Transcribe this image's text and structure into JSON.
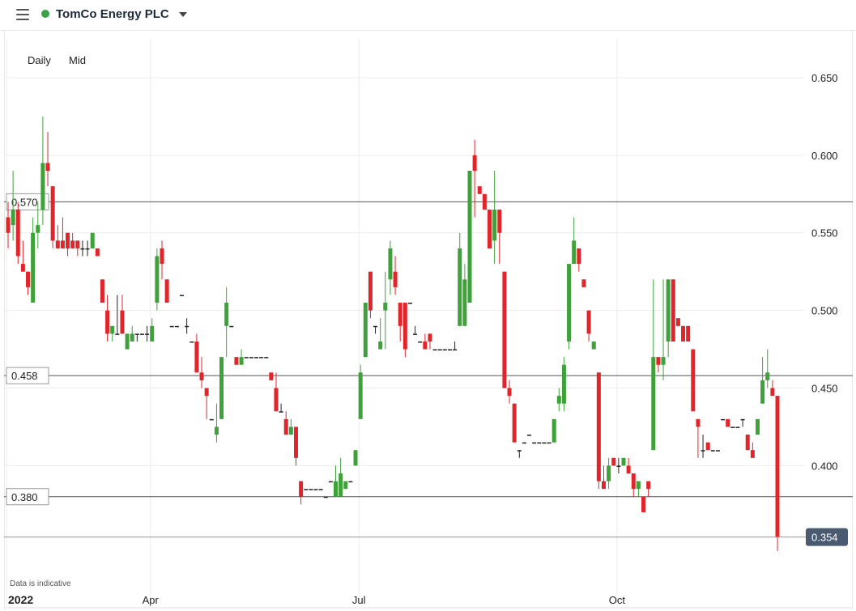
{
  "header": {
    "menu_icon": "hamburger-menu-icon",
    "status_color": "#3aa04a",
    "instrument_name": "TomCo Energy PLC",
    "dropdown_icon": "caret-down-icon"
  },
  "controls": {
    "interval_label": "Daily",
    "price_type_label": "Mid"
  },
  "disclaimer": "Data is indicative",
  "colors": {
    "up": "#3fa13a",
    "down": "#e0252b",
    "last_price_bg": "#4a5a70"
  },
  "chart_data": {
    "type": "candlestick",
    "y_axis_side": "right",
    "ylim": [
      0.31,
      0.675
    ],
    "y_ticks": [
      0.65,
      0.6,
      0.55,
      0.5,
      0.45,
      0.4
    ],
    "y_tick_labels": [
      "0.650",
      "0.600",
      "0.550",
      "0.500",
      "0.450",
      "0.400"
    ],
    "x_labels": [
      {
        "label": "2022",
        "index": 0
      },
      {
        "label": "Apr",
        "index": 29
      },
      {
        "label": "Jul",
        "index": 71
      },
      {
        "label": "Oct",
        "index": 123
      }
    ],
    "horizontal_lines": [
      {
        "value": 0.57,
        "label": "0.570"
      },
      {
        "value": 0.458,
        "label": "0.458"
      },
      {
        "value": 0.38,
        "label": "0.380"
      }
    ],
    "last_price": {
      "value": 0.354,
      "label": "0.354"
    },
    "candles": [
      {
        "o": 0.56,
        "h": 0.57,
        "l": 0.54,
        "c": 0.55
      },
      {
        "o": 0.555,
        "h": 0.59,
        "l": 0.545,
        "c": 0.565
      },
      {
        "o": 0.565,
        "h": 0.57,
        "l": 0.53,
        "c": 0.535
      },
      {
        "o": 0.53,
        "h": 0.545,
        "l": 0.525,
        "c": 0.525
      },
      {
        "o": 0.525,
        "h": 0.52,
        "l": 0.51,
        "c": 0.515
      },
      {
        "o": 0.505,
        "h": 0.56,
        "l": 0.505,
        "c": 0.55
      },
      {
        "o": 0.55,
        "h": 0.57,
        "l": 0.54,
        "c": 0.555
      },
      {
        "o": 0.565,
        "h": 0.625,
        "l": 0.555,
        "c": 0.595
      },
      {
        "o": 0.595,
        "h": 0.615,
        "l": 0.58,
        "c": 0.59
      },
      {
        "o": 0.58,
        "h": 0.58,
        "l": 0.54,
        "c": 0.545
      },
      {
        "o": 0.545,
        "h": 0.555,
        "l": 0.54,
        "c": 0.54
      },
      {
        "o": 0.545,
        "h": 0.56,
        "l": 0.54,
        "c": 0.54
      },
      {
        "o": 0.55,
        "h": 0.55,
        "l": 0.535,
        "c": 0.54
      },
      {
        "o": 0.545,
        "h": 0.55,
        "l": 0.54,
        "c": 0.54
      },
      {
        "o": 0.545,
        "h": 0.545,
        "l": 0.535,
        "c": 0.54
      },
      {
        "o": 0.54,
        "h": 0.545,
        "l": 0.535,
        "c": 0.54
      },
      {
        "o": 0.54,
        "h": 0.545,
        "l": 0.535,
        "c": 0.54
      },
      {
        "o": 0.54,
        "h": 0.55,
        "l": 0.54,
        "c": 0.55
      },
      {
        "o": 0.54,
        "h": 0.54,
        "l": 0.535,
        "c": 0.535
      },
      {
        "o": 0.52,
        "h": 0.52,
        "l": 0.505,
        "c": 0.505
      },
      {
        "o": 0.5,
        "h": 0.51,
        "l": 0.48,
        "c": 0.485
      },
      {
        "o": 0.485,
        "h": 0.49,
        "l": 0.48,
        "c": 0.49
      },
      {
        "o": 0.485,
        "h": 0.51,
        "l": 0.485,
        "c": 0.485
      },
      {
        "o": 0.5,
        "h": 0.51,
        "l": 0.485,
        "c": 0.485
      },
      {
        "o": 0.475,
        "h": 0.485,
        "l": 0.475,
        "c": 0.485
      },
      {
        "o": 0.48,
        "h": 0.49,
        "l": 0.48,
        "c": 0.485
      },
      {
        "o": 0.485,
        "h": 0.485,
        "l": 0.48,
        "c": 0.485
      },
      {
        "o": 0.485,
        "h": 0.485,
        "l": 0.485,
        "c": 0.485
      },
      {
        "o": 0.485,
        "h": 0.49,
        "l": 0.48,
        "c": 0.485
      },
      {
        "o": 0.48,
        "h": 0.495,
        "l": 0.48,
        "c": 0.49
      },
      {
        "o": 0.505,
        "h": 0.54,
        "l": 0.5,
        "c": 0.535
      },
      {
        "o": 0.54,
        "h": 0.545,
        "l": 0.52,
        "c": 0.53
      },
      {
        "o": 0.52,
        "h": 0.52,
        "l": 0.505,
        "c": 0.505
      },
      {
        "o": 0.49,
        "h": 0.49,
        "l": 0.49,
        "c": 0.49
      },
      {
        "o": 0.49,
        "h": 0.49,
        "l": 0.49,
        "c": 0.49
      },
      {
        "o": 0.51,
        "h": 0.51,
        "l": 0.51,
        "c": 0.51
      },
      {
        "o": 0.49,
        "h": 0.495,
        "l": 0.485,
        "c": 0.49
      },
      {
        "o": 0.48,
        "h": 0.48,
        "l": 0.48,
        "c": 0.48
      },
      {
        "o": 0.48,
        "h": 0.485,
        "l": 0.46,
        "c": 0.46
      },
      {
        "o": 0.46,
        "h": 0.47,
        "l": 0.45,
        "c": 0.455
      },
      {
        "o": 0.45,
        "h": 0.45,
        "l": 0.43,
        "c": 0.445
      },
      {
        "o": 0.43,
        "h": 0.43,
        "l": 0.43,
        "c": 0.43
      },
      {
        "o": 0.42,
        "h": 0.44,
        "l": 0.415,
        "c": 0.425
      },
      {
        "o": 0.43,
        "h": 0.47,
        "l": 0.43,
        "c": 0.47
      },
      {
        "o": 0.49,
        "h": 0.515,
        "l": 0.47,
        "c": 0.505
      },
      {
        "o": 0.49,
        "h": 0.49,
        "l": 0.49,
        "c": 0.49
      },
      {
        "o": 0.47,
        "h": 0.47,
        "l": 0.465,
        "c": 0.465
      },
      {
        "o": 0.465,
        "h": 0.475,
        "l": 0.465,
        "c": 0.47
      },
      {
        "o": 0.47,
        "h": 0.47,
        "l": 0.47,
        "c": 0.47
      },
      {
        "o": 0.47,
        "h": 0.47,
        "l": 0.47,
        "c": 0.47
      },
      {
        "o": 0.47,
        "h": 0.47,
        "l": 0.47,
        "c": 0.47
      },
      {
        "o": 0.47,
        "h": 0.47,
        "l": 0.47,
        "c": 0.47
      },
      {
        "o": 0.47,
        "h": 0.47,
        "l": 0.47,
        "c": 0.47
      },
      {
        "o": 0.46,
        "h": 0.46,
        "l": 0.455,
        "c": 0.455
      },
      {
        "o": 0.45,
        "h": 0.46,
        "l": 0.435,
        "c": 0.435
      },
      {
        "o": 0.435,
        "h": 0.44,
        "l": 0.435,
        "c": 0.435
      },
      {
        "o": 0.43,
        "h": 0.435,
        "l": 0.42,
        "c": 0.42
      },
      {
        "o": 0.42,
        "h": 0.43,
        "l": 0.42,
        "c": 0.425
      },
      {
        "o": 0.425,
        "h": 0.425,
        "l": 0.4,
        "c": 0.405
      },
      {
        "o": 0.39,
        "h": 0.39,
        "l": 0.375,
        "c": 0.38
      },
      {
        "o": 0.385,
        "h": 0.385,
        "l": 0.385,
        "c": 0.385
      },
      {
        "o": 0.385,
        "h": 0.385,
        "l": 0.385,
        "c": 0.385
      },
      {
        "o": 0.385,
        "h": 0.385,
        "l": 0.385,
        "c": 0.385
      },
      {
        "o": 0.385,
        "h": 0.385,
        "l": 0.385,
        "c": 0.385
      },
      {
        "o": 0.38,
        "h": 0.38,
        "l": 0.38,
        "c": 0.38
      },
      {
        "o": 0.39,
        "h": 0.39,
        "l": 0.39,
        "c": 0.39
      },
      {
        "o": 0.38,
        "h": 0.4,
        "l": 0.38,
        "c": 0.39
      },
      {
        "o": 0.38,
        "h": 0.405,
        "l": 0.38,
        "c": 0.395
      },
      {
        "o": 0.385,
        "h": 0.39,
        "l": 0.385,
        "c": 0.39
      },
      {
        "o": 0.39,
        "h": 0.39,
        "l": 0.39,
        "c": 0.39
      },
      {
        "o": 0.4,
        "h": 0.41,
        "l": 0.4,
        "c": 0.41
      },
      {
        "o": 0.43,
        "h": 0.465,
        "l": 0.43,
        "c": 0.46
      },
      {
        "o": 0.47,
        "h": 0.505,
        "l": 0.47,
        "c": 0.505
      },
      {
        "o": 0.525,
        "h": 0.525,
        "l": 0.495,
        "c": 0.5
      },
      {
        "o": 0.49,
        "h": 0.49,
        "l": 0.485,
        "c": 0.49
      },
      {
        "o": 0.475,
        "h": 0.495,
        "l": 0.475,
        "c": 0.48
      },
      {
        "o": 0.5,
        "h": 0.525,
        "l": 0.475,
        "c": 0.505
      },
      {
        "o": 0.52,
        "h": 0.545,
        "l": 0.51,
        "c": 0.54
      },
      {
        "o": 0.525,
        "h": 0.535,
        "l": 0.51,
        "c": 0.515
      },
      {
        "o": 0.505,
        "h": 0.505,
        "l": 0.48,
        "c": 0.49
      },
      {
        "o": 0.505,
        "h": 0.505,
        "l": 0.47,
        "c": 0.475
      },
      {
        "o": 0.505,
        "h": 0.505,
        "l": 0.505,
        "c": 0.505
      },
      {
        "o": 0.485,
        "h": 0.49,
        "l": 0.485,
        "c": 0.485
      },
      {
        "o": 0.48,
        "h": 0.48,
        "l": 0.48,
        "c": 0.48
      },
      {
        "o": 0.48,
        "h": 0.485,
        "l": 0.475,
        "c": 0.475
      },
      {
        "o": 0.485,
        "h": 0.485,
        "l": 0.475,
        "c": 0.48
      },
      {
        "o": 0.475,
        "h": 0.475,
        "l": 0.475,
        "c": 0.475
      },
      {
        "o": 0.475,
        "h": 0.475,
        "l": 0.475,
        "c": 0.475
      },
      {
        "o": 0.475,
        "h": 0.475,
        "l": 0.475,
        "c": 0.475
      },
      {
        "o": 0.475,
        "h": 0.475,
        "l": 0.475,
        "c": 0.475
      },
      {
        "o": 0.475,
        "h": 0.48,
        "l": 0.475,
        "c": 0.475
      },
      {
        "o": 0.49,
        "h": 0.55,
        "l": 0.49,
        "c": 0.54
      },
      {
        "o": 0.49,
        "h": 0.53,
        "l": 0.49,
        "c": 0.52
      },
      {
        "o": 0.505,
        "h": 0.575,
        "l": 0.505,
        "c": 0.59
      },
      {
        "o": 0.6,
        "h": 0.61,
        "l": 0.56,
        "c": 0.59
      },
      {
        "o": 0.58,
        "h": 0.58,
        "l": 0.575,
        "c": 0.575
      },
      {
        "o": 0.575,
        "h": 0.575,
        "l": 0.565,
        "c": 0.565
      },
      {
        "o": 0.565,
        "h": 0.565,
        "l": 0.54,
        "c": 0.54
      },
      {
        "o": 0.545,
        "h": 0.59,
        "l": 0.53,
        "c": 0.565
      },
      {
        "o": 0.565,
        "h": 0.565,
        "l": 0.53,
        "c": 0.55
      },
      {
        "o": 0.525,
        "h": 0.525,
        "l": 0.45,
        "c": 0.45
      },
      {
        "o": 0.45,
        "h": 0.455,
        "l": 0.44,
        "c": 0.445
      },
      {
        "o": 0.44,
        "h": 0.44,
        "l": 0.415,
        "c": 0.415
      },
      {
        "o": 0.41,
        "h": 0.41,
        "l": 0.405,
        "c": 0.41
      },
      {
        "o": 0.415,
        "h": 0.415,
        "l": 0.415,
        "c": 0.415
      },
      {
        "o": 0.42,
        "h": 0.42,
        "l": 0.42,
        "c": 0.42
      },
      {
        "o": 0.415,
        "h": 0.415,
        "l": 0.415,
        "c": 0.415
      },
      {
        "o": 0.415,
        "h": 0.415,
        "l": 0.415,
        "c": 0.415
      },
      {
        "o": 0.415,
        "h": 0.415,
        "l": 0.415,
        "c": 0.415
      },
      {
        "o": 0.415,
        "h": 0.415,
        "l": 0.415,
        "c": 0.415
      },
      {
        "o": 0.415,
        "h": 0.43,
        "l": 0.415,
        "c": 0.43
      },
      {
        "o": 0.44,
        "h": 0.45,
        "l": 0.435,
        "c": 0.445
      },
      {
        "o": 0.44,
        "h": 0.47,
        "l": 0.435,
        "c": 0.465
      },
      {
        "o": 0.48,
        "h": 0.53,
        "l": 0.475,
        "c": 0.53
      },
      {
        "o": 0.53,
        "h": 0.56,
        "l": 0.53,
        "c": 0.545
      },
      {
        "o": 0.54,
        "h": 0.54,
        "l": 0.525,
        "c": 0.53
      },
      {
        "o": 0.52,
        "h": 0.52,
        "l": 0.515,
        "c": 0.515
      },
      {
        "o": 0.5,
        "h": 0.5,
        "l": 0.48,
        "c": 0.485
      },
      {
        "o": 0.475,
        "h": 0.48,
        "l": 0.475,
        "c": 0.48
      },
      {
        "o": 0.46,
        "h": 0.46,
        "l": 0.385,
        "c": 0.39
      },
      {
        "o": 0.39,
        "h": 0.4,
        "l": 0.385,
        "c": 0.385
      },
      {
        "o": 0.39,
        "h": 0.405,
        "l": 0.385,
        "c": 0.4
      },
      {
        "o": 0.405,
        "h": 0.405,
        "l": 0.4,
        "c": 0.4
      },
      {
        "o": 0.4,
        "h": 0.405,
        "l": 0.395,
        "c": 0.4
      },
      {
        "o": 0.4,
        "h": 0.405,
        "l": 0.4,
        "c": 0.405
      },
      {
        "o": 0.4,
        "h": 0.405,
        "l": 0.395,
        "c": 0.395
      },
      {
        "o": 0.395,
        "h": 0.395,
        "l": 0.38,
        "c": 0.385
      },
      {
        "o": 0.385,
        "h": 0.385,
        "l": 0.38,
        "c": 0.39
      },
      {
        "o": 0.38,
        "h": 0.38,
        "l": 0.37,
        "c": 0.37
      },
      {
        "o": 0.39,
        "h": 0.39,
        "l": 0.38,
        "c": 0.385
      },
      {
        "o": 0.41,
        "h": 0.52,
        "l": 0.41,
        "c": 0.47
      },
      {
        "o": 0.47,
        "h": 0.47,
        "l": 0.46,
        "c": 0.465
      },
      {
        "o": 0.465,
        "h": 0.52,
        "l": 0.455,
        "c": 0.47
      },
      {
        "o": 0.48,
        "h": 0.5,
        "l": 0.47,
        "c": 0.52
      },
      {
        "o": 0.52,
        "h": 0.52,
        "l": 0.48,
        "c": 0.48
      },
      {
        "o": 0.495,
        "h": 0.495,
        "l": 0.49,
        "c": 0.49
      },
      {
        "o": 0.49,
        "h": 0.49,
        "l": 0.48,
        "c": 0.48
      },
      {
        "o": 0.49,
        "h": 0.49,
        "l": 0.48,
        "c": 0.48
      },
      {
        "o": 0.475,
        "h": 0.475,
        "l": 0.435,
        "c": 0.435
      },
      {
        "o": 0.43,
        "h": 0.43,
        "l": 0.405,
        "c": 0.425
      },
      {
        "o": 0.41,
        "h": 0.42,
        "l": 0.405,
        "c": 0.41
      },
      {
        "o": 0.415,
        "h": 0.415,
        "l": 0.41,
        "c": 0.41
      },
      {
        "o": 0.41,
        "h": 0.41,
        "l": 0.41,
        "c": 0.41
      },
      {
        "o": 0.41,
        "h": 0.41,
        "l": 0.41,
        "c": 0.41
      },
      {
        "o": 0.43,
        "h": 0.43,
        "l": 0.43,
        "c": 0.43
      },
      {
        "o": 0.43,
        "h": 0.43,
        "l": 0.425,
        "c": 0.425
      },
      {
        "o": 0.425,
        "h": 0.425,
        "l": 0.425,
        "c": 0.425
      },
      {
        "o": 0.425,
        "h": 0.425,
        "l": 0.425,
        "c": 0.425
      },
      {
        "o": 0.43,
        "h": 0.43,
        "l": 0.425,
        "c": 0.43
      },
      {
        "o": 0.42,
        "h": 0.42,
        "l": 0.41,
        "c": 0.41
      },
      {
        "o": 0.41,
        "h": 0.415,
        "l": 0.405,
        "c": 0.405
      },
      {
        "o": 0.42,
        "h": 0.43,
        "l": 0.42,
        "c": 0.43
      },
      {
        "o": 0.44,
        "h": 0.47,
        "l": 0.44,
        "c": 0.455
      },
      {
        "o": 0.455,
        "h": 0.475,
        "l": 0.45,
        "c": 0.46
      },
      {
        "o": 0.45,
        "h": 0.455,
        "l": 0.445,
        "c": 0.445
      },
      {
        "o": 0.445,
        "h": 0.445,
        "l": 0.345,
        "c": 0.354
      }
    ]
  }
}
